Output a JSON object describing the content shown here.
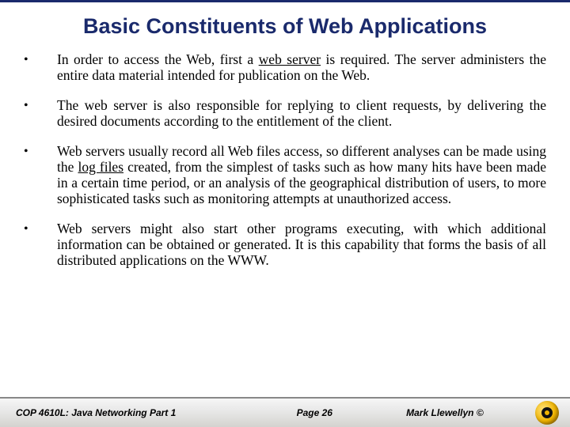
{
  "title": "Basic Constituents of Web Applications",
  "bullets": [
    {
      "pre": "In order to access the Web, first a ",
      "u": "web server",
      "post": " is required.  The server administers the entire data material intended for publication on the Web."
    },
    {
      "pre": "The web server is also responsible for replying to client requests, by delivering the desired documents according to the entitlement of the client.",
      "u": "",
      "post": ""
    },
    {
      "pre": "Web servers usually record all Web files access, so different analyses can be made using the ",
      "u": "log files",
      "post": " created, from the simplest of tasks such as how many hits have been made in a certain time period, or an analysis of the geographical distribution of users, to more sophisticated tasks such as monitoring attempts at unauthorized access."
    },
    {
      "pre": "Web servers might also start other programs executing, with which additional information can be obtained or generated.  It is this capability that forms the basis of all distributed applications on the WWW.",
      "u": "",
      "post": ""
    }
  ],
  "footer": {
    "course": "COP 4610L: Java Networking Part 1",
    "page": "Page 26",
    "author": "Mark Llewellyn ©"
  }
}
